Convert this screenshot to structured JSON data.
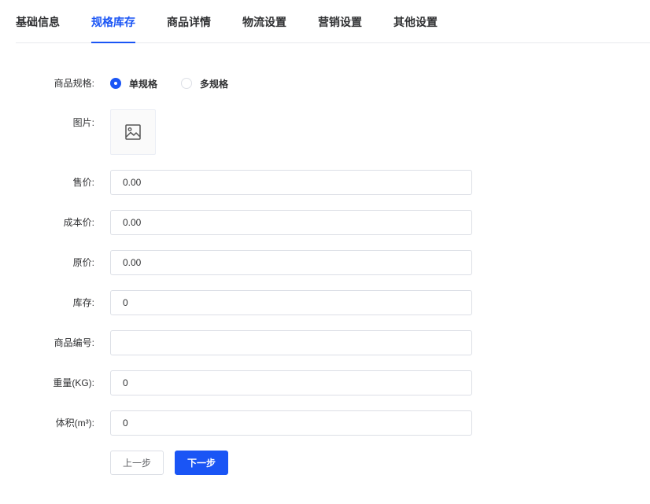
{
  "tabs": [
    {
      "label": "基础信息",
      "active": false
    },
    {
      "label": "规格库存",
      "active": true
    },
    {
      "label": "商品详情",
      "active": false
    },
    {
      "label": "物流设置",
      "active": false
    },
    {
      "label": "营销设置",
      "active": false
    },
    {
      "label": "其他设置",
      "active": false
    }
  ],
  "spec": {
    "label": "商品规格:",
    "options": [
      {
        "label": "单规格",
        "checked": true
      },
      {
        "label": "多规格",
        "checked": false
      }
    ]
  },
  "image": {
    "label": "图片:",
    "icon": "image-placeholder-icon"
  },
  "fields": {
    "price": {
      "label": "售价:",
      "value": "0.00"
    },
    "cost": {
      "label": "成本价:",
      "value": "0.00"
    },
    "original_price": {
      "label": "原价:",
      "value": "0.00"
    },
    "stock": {
      "label": "库存:",
      "value": "0"
    },
    "sku_code": {
      "label": "商品编号:",
      "value": ""
    },
    "weight": {
      "label": "重量(KG):",
      "value": "0"
    },
    "volume": {
      "label": "体积(m³):",
      "value": "0"
    }
  },
  "buttons": {
    "prev": "上一步",
    "next": "下一步"
  },
  "colors": {
    "accent": "#1a55f5",
    "border": "#dcdfe6",
    "text": "#303133"
  }
}
